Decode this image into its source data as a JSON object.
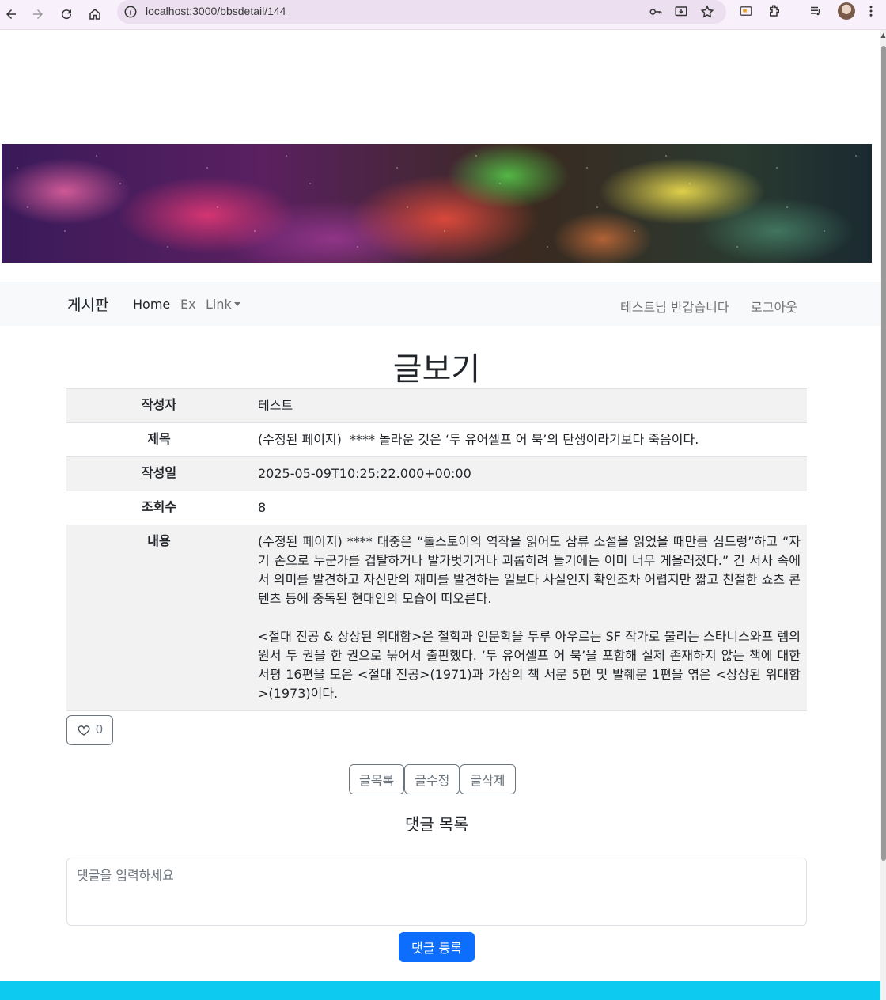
{
  "browser": {
    "url": "localhost:3000/bbsdetail/144"
  },
  "navbar": {
    "brand": "게시판",
    "links": [
      "Home",
      "Ex",
      "Link"
    ],
    "greeting": "테스트님 반갑습니다",
    "logout": "로그아웃"
  },
  "page": {
    "title": "글보기"
  },
  "detail": {
    "rows": [
      {
        "label": "작성자",
        "value": "테스트"
      },
      {
        "label": "제목",
        "value": "(수정된 페이지)  **** 놀라운 것은 ‘두 유어셀프 어 북’의 탄생이라기보다 죽음이다."
      },
      {
        "label": "작성일",
        "value": "2025-05-09T10:25:22.000+00:00"
      },
      {
        "label": "조회수",
        "value": "8"
      }
    ],
    "content_label": "내용",
    "content_p1": "(수정된 페이지) **** 대중은 “톨스토이의 역작을 읽어도 삼류 소설을 읽었을 때만큼 심드렁”하고 “자기 손으로 누군가를 겁탈하거나 발가벗기거나 괴롭히려 들기에는 이미 너무 게을러졌다.” 긴 서사 속에서 의미를 발견하고 자신만의 재미를 발견하는 일보다 사실인지 확인조차 어렵지만 짧고 친절한 쇼츠 콘텐츠 등에 중독된 현대인의 모습이 떠오른다.",
    "content_p2": "<절대 진공 & 상상된 위대함>은 철학과 인문학을 두루 아우르는 SF 작가로 불리는 스타니스와프 렘의 원서 두 권을 한 권으로 묶어서 출판했다. ‘두 유어셀프 어 북’을 포함해 실제 존재하지 않는 책에 대한 서평 16편을 모은 <절대 진공>(1971)과 가상의 책 서문 5편 및 발췌문 1편을 엮은 <상상된 위대함>(1973)이다."
  },
  "like": {
    "count": "0"
  },
  "actions": {
    "list": "글목록",
    "edit": "글수정",
    "delete": "글삭제"
  },
  "comments": {
    "heading": "댓글 목록",
    "placeholder": "댓글을 입력하세요",
    "submit": "댓글 등록"
  },
  "colors": {
    "primary": "#0d6efd",
    "footer": "#0dcaf0",
    "navbar_bg": "#f8f9fa"
  }
}
